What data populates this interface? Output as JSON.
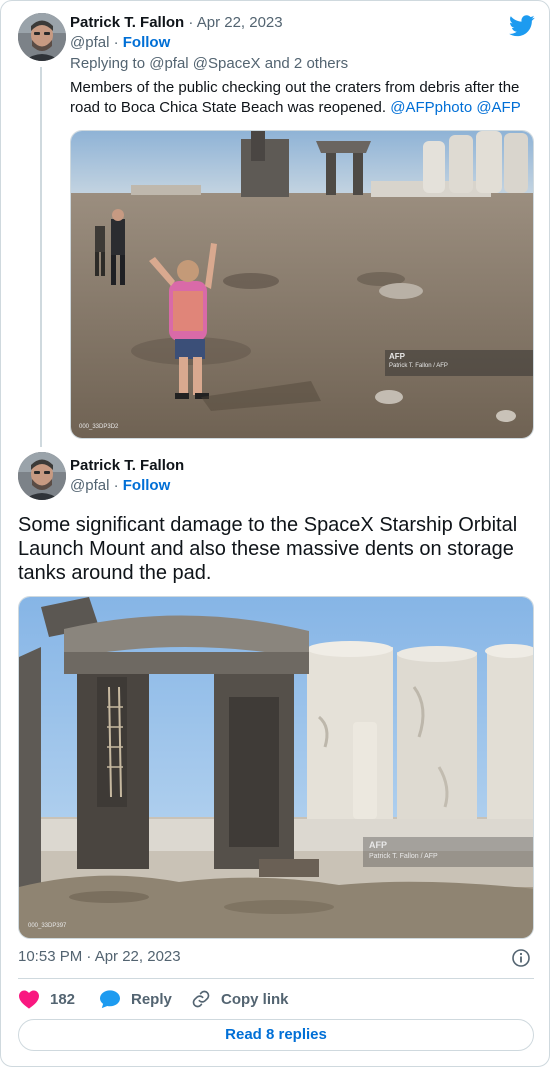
{
  "tweet1": {
    "author_name": "Patrick T. Fallon",
    "separator": "·",
    "date": "Apr 22, 2023",
    "handle": "@pfal",
    "follow_label": "Follow",
    "reply_prefix": "Replying to",
    "reply_mentions": "@pfal @SpaceX",
    "reply_suffix": "and 2 others",
    "text": "Members of the public  checking out the craters from debris after the road to Boca Chica State Beach was reopened.",
    "text_links": "@AFPphoto @AFP",
    "photo": {
      "watermark": "AFP",
      "credit": "Patrick T. Fallon / AFP",
      "photo_id": "000_33DP3D2"
    }
  },
  "tweet2": {
    "author_name": "Patrick T. Fallon",
    "handle": "@pfal",
    "follow_label": "Follow",
    "text": "Some significant damage to the SpaceX Starship Orbital Launch Mount and also these massive dents on storage tanks around the pad.",
    "photo": {
      "watermark": "AFP",
      "credit": "Patrick T. Fallon / AFP",
      "photo_id": "000_33DP397"
    },
    "timestamp": "10:53 PM · Apr 22, 2023"
  },
  "actions": {
    "like_count": "182",
    "reply_label": "Reply",
    "copy_link_label": "Copy link"
  },
  "read_replies_label": "Read 8 replies",
  "icons": {
    "brand": "twitter-bird-icon",
    "like": "heart-icon",
    "reply": "speech-bubble-icon",
    "copy": "link-icon",
    "info": "info-icon"
  },
  "colors": {
    "link": "#006fd6",
    "brand": "#1d9bf0",
    "like": "#f91880",
    "muted": "#536471",
    "border": "#cfd9de"
  }
}
